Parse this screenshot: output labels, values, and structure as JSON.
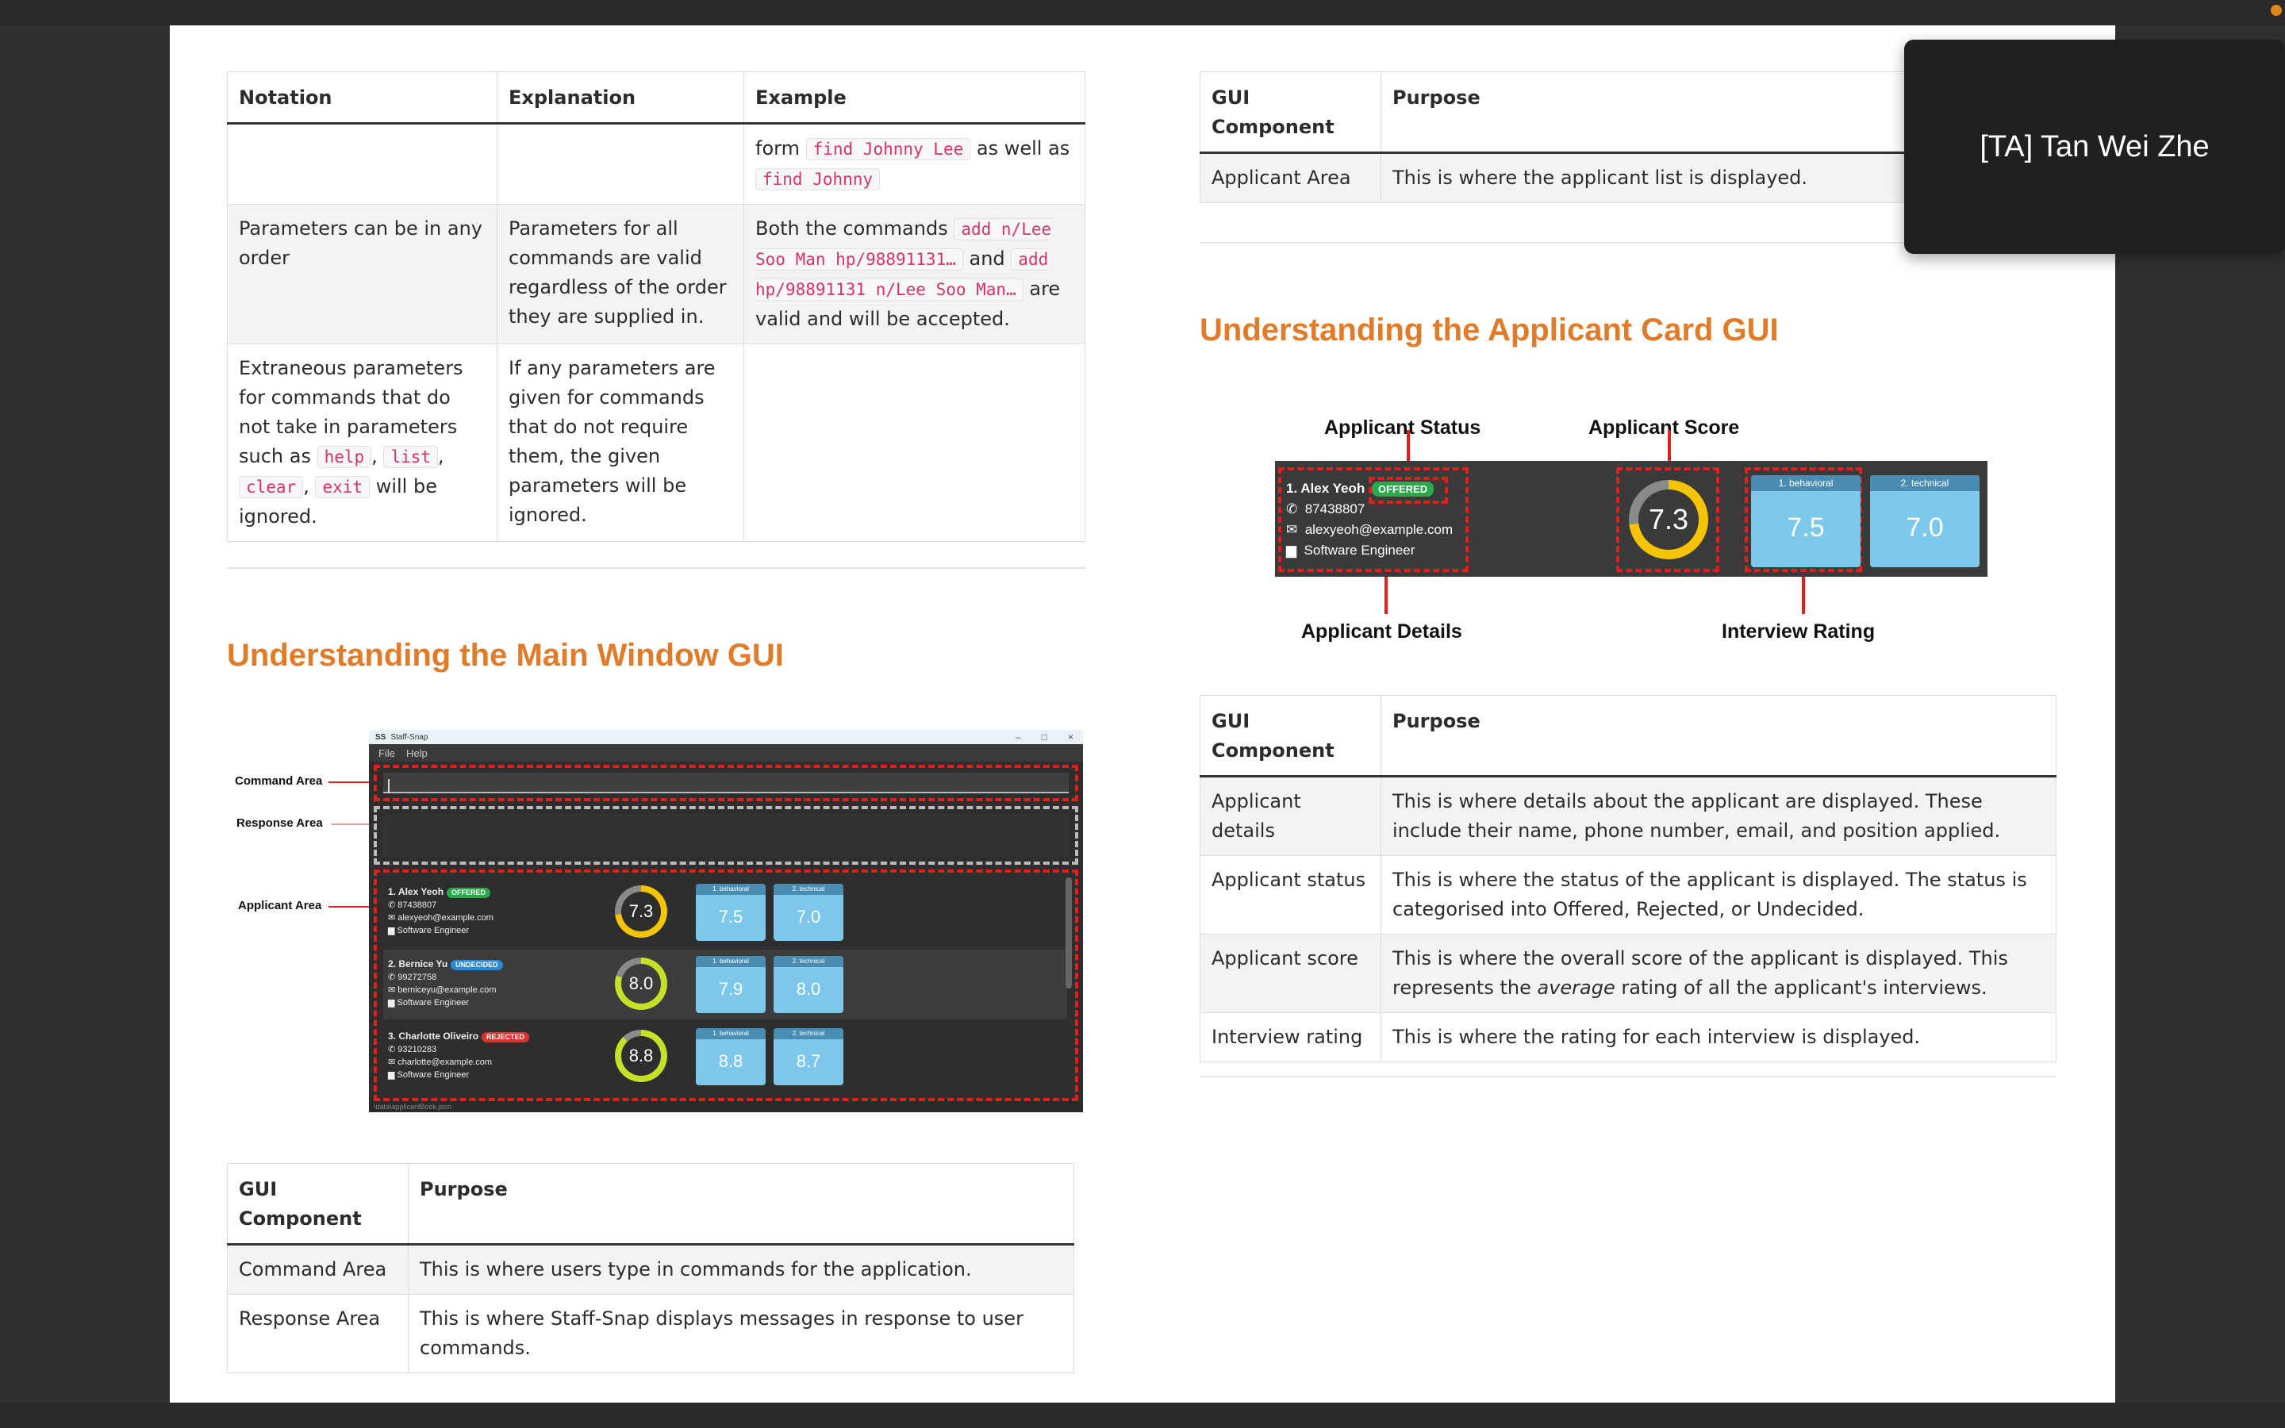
{
  "notation_table": {
    "headers": [
      "Notation",
      "Explanation",
      "Example"
    ],
    "row0": {
      "notation": "",
      "explanation": "",
      "ex_pre": "form ",
      "code1": "find Johnny Lee",
      "ex_mid": " as well as",
      "code2": "find Johnny"
    },
    "row1": {
      "notation": "Parameters can be in any order",
      "explanation": "Parameters for all commands are valid regardless of the order they are supplied in.",
      "ex_pre": "Both the commands ",
      "code1": "add n/Lee Soo Man hp/98891131…",
      "ex_mid": " and ",
      "code2": "add hp/98891131 n/Lee Soo Man…",
      "ex_post": " are valid and will be accepted."
    },
    "row2": {
      "notation_pre": "Extraneous parameters for commands that do not take in parameters such as ",
      "code1": "help",
      "code2": "list",
      "code3": "clear",
      "code4": "exit",
      "sep": ", ",
      "notation_post": " will be ignored.",
      "explanation": "If any parameters are given for commands that do not require them, the given parameters will be ignored.",
      "example": ""
    }
  },
  "main_window_section": {
    "heading": "Understanding the Main Window GUI",
    "labels": {
      "command": "Command Area",
      "response": "Response Area",
      "applicant": "Applicant Area"
    },
    "window": {
      "title": "Staff-Snap",
      "menu": [
        "File",
        "Help"
      ],
      "status": "\\data\\applicantBook.json",
      "applicants": [
        {
          "name": "1.  Alex Yeoh",
          "status": "OFFERED",
          "phone": "87438807",
          "email": "alexyeoh@example.com",
          "position": "Software Engineer",
          "score": "7.3",
          "score_fraction": 0.73,
          "ring_color": "#f5c400",
          "ratings": [
            {
              "label": "1. behavioral",
              "value": "7.5"
            },
            {
              "label": "2. technical",
              "value": "7.0"
            }
          ]
        },
        {
          "name": "2.  Bernice Yu",
          "status": "UNDECIDED",
          "phone": "99272758",
          "email": "berniceyu@example.com",
          "position": "Software Engineer",
          "score": "8.0",
          "score_fraction": 0.8,
          "ring_color": "#c6e02a",
          "ratings": [
            {
              "label": "1. behavioral",
              "value": "7.9"
            },
            {
              "label": "2. technical",
              "value": "8.0"
            }
          ]
        },
        {
          "name": "3.  Charlotte Oliveiro",
          "status": "REJECTED",
          "phone": "93210283",
          "email": "charlotte@example.com",
          "position": "Software Engineer",
          "score": "8.8",
          "score_fraction": 0.88,
          "ring_color": "#c6e02a",
          "ratings": [
            {
              "label": "1. behavioral",
              "value": "8.8"
            },
            {
              "label": "2. technical",
              "value": "8.7"
            }
          ]
        }
      ]
    },
    "table": {
      "headers": [
        "GUI Component",
        "Purpose"
      ],
      "rows": [
        {
          "component": "Command Area",
          "purpose": "This is where users type in commands for the application."
        },
        {
          "component": "Response Area",
          "purpose": "This is where Staff-Snap displays messages in response to user commands."
        }
      ]
    }
  },
  "right_top_table": {
    "headers": [
      "GUI Component",
      "Purpose"
    ],
    "rows": [
      {
        "component": "Applicant Area",
        "purpose": "This is where the applicant list is displayed."
      }
    ]
  },
  "applicant_card_section": {
    "heading": "Understanding the Applicant Card GUI",
    "labels": {
      "status": "Applicant Status",
      "score": "Applicant Score",
      "details": "Applicant Details",
      "rating": "Interview Rating"
    },
    "card": {
      "name": "1.  Alex Yeoh",
      "status": "OFFERED",
      "phone": "87438807",
      "email": "alexyeoh@example.com",
      "position": "Software Engineer",
      "score": "7.3",
      "score_fraction": 0.73,
      "ratings": [
        {
          "label": "1. behavioral",
          "value": "7.5"
        },
        {
          "label": "2. technical",
          "value": "7.0"
        }
      ]
    },
    "table": {
      "headers": [
        "GUI Component",
        "Purpose"
      ],
      "rows": [
        {
          "component": "Applicant details",
          "purpose": "This is where details about the applicant are displayed. These include their name, phone number, email, and position applied."
        },
        {
          "component": "Applicant status",
          "purpose": "This is where the status of the applicant is displayed. The status is categorised into Offered, Rejected, or Undecided."
        },
        {
          "component": "Applicant score",
          "purpose_pre": "This is where the overall score of the applicant is displayed. This represents the ",
          "purpose_em": "average",
          "purpose_post": " rating of all the applicant's interviews."
        },
        {
          "component": "Interview rating",
          "purpose": "This is where the rating for each interview is displayed."
        }
      ]
    }
  },
  "overlay": {
    "participant": "[TA] Tan Wei Zhe"
  },
  "colors": {
    "heading": "#e07b2a",
    "annotation_red": "#e0201b",
    "tile_blue": "#7cc7ea"
  },
  "icons": [
    "phone-icon",
    "mail-icon",
    "briefcase-icon"
  ]
}
